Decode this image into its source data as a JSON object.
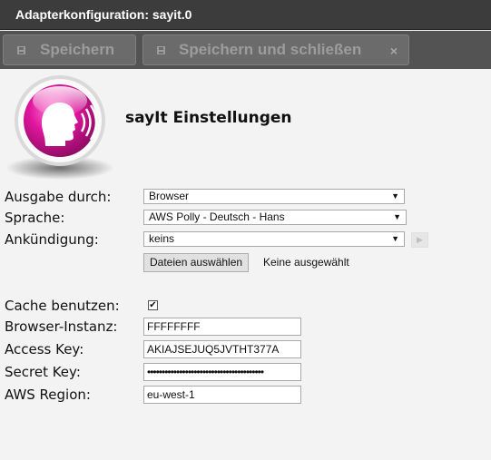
{
  "window": {
    "title": "Adapterkonfiguration: sayit.0"
  },
  "toolbar": {
    "save_label": "Speichern",
    "save_close_label": "Speichern und schließen",
    "close_glyph": "×"
  },
  "page": {
    "heading": "sayIt Einstellungen"
  },
  "form": {
    "output": {
      "label": "Ausgabe durch:",
      "value": "Browser"
    },
    "language": {
      "label": "Sprache:",
      "value": "AWS Polly - Deutsch - Hans"
    },
    "announce": {
      "label": "Ankündigung:",
      "value": "keins"
    },
    "file": {
      "button_label": "Dateien auswählen",
      "status": "Keine ausgewählt"
    },
    "cache": {
      "label": "Cache benutzen:",
      "checked": true,
      "check_glyph": "✔"
    },
    "browser_instance": {
      "label": "Browser-Instanz:",
      "value": "FFFFFFFF"
    },
    "access_key": {
      "label": "Access Key:",
      "value": "AKIAJSEJUQ5JVTHT377A"
    },
    "secret_key": {
      "label": "Secret Key:",
      "value": "••••••••••••••••••••••••••••••••••••••••"
    },
    "aws_region": {
      "label": "AWS Region:",
      "value": "eu-west-1"
    }
  },
  "icons": {
    "select_arrow": "▼",
    "play": "▶",
    "save": "floppy-disk-icon",
    "logo": "speaking-head-icon"
  },
  "colors": {
    "titlebar": "#3c3c3c",
    "toolbar": "#535353",
    "logo_magenta": "#e0169e",
    "background": "#f3f3f3"
  }
}
